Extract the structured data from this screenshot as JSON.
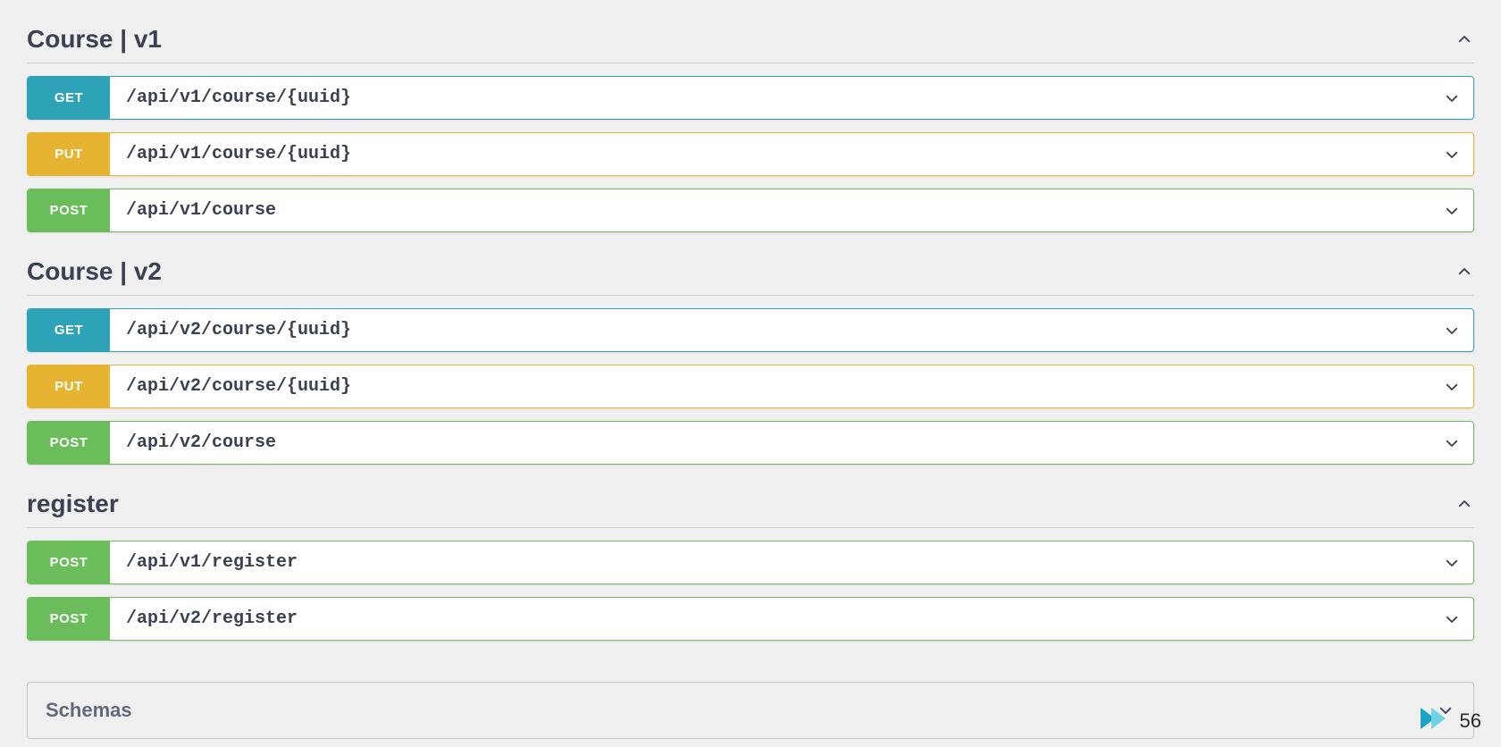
{
  "tags": [
    {
      "title": "Course | v1",
      "endpoints": [
        {
          "method": "GET",
          "path": "/api/v1/course/{uuid}"
        },
        {
          "method": "PUT",
          "path": "/api/v1/course/{uuid}"
        },
        {
          "method": "POST",
          "path": "/api/v1/course"
        }
      ]
    },
    {
      "title": "Course | v2",
      "endpoints": [
        {
          "method": "GET",
          "path": "/api/v2/course/{uuid}"
        },
        {
          "method": "PUT",
          "path": "/api/v2/course/{uuid}"
        },
        {
          "method": "POST",
          "path": "/api/v2/course"
        }
      ]
    },
    {
      "title": "register",
      "endpoints": [
        {
          "method": "POST",
          "path": "/api/v1/register"
        },
        {
          "method": "POST",
          "path": "/api/v2/register"
        }
      ]
    }
  ],
  "schemas": {
    "title": "Schemas"
  },
  "slide": {
    "number": "56"
  },
  "colors": {
    "get": "#2ea3b7",
    "put": "#e6b430",
    "post": "#6bbd5b",
    "brand_forward": "#35b6d6"
  }
}
